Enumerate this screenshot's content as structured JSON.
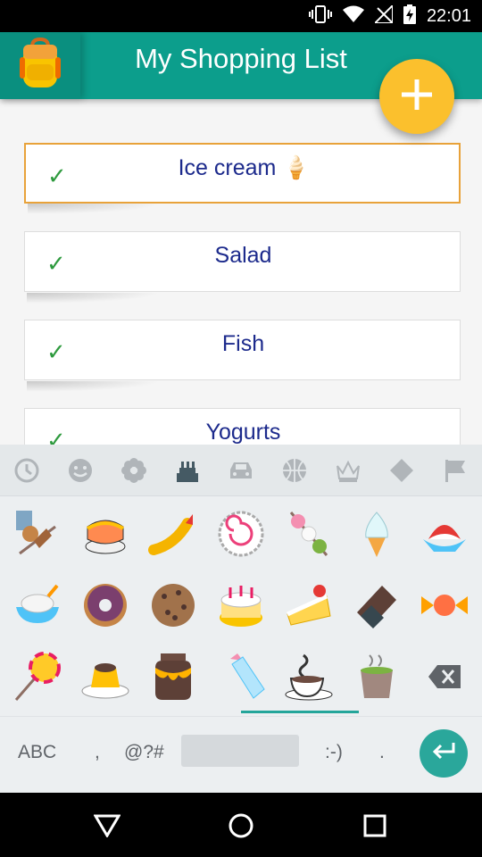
{
  "status_bar": {
    "time": "22:01",
    "icons": [
      "vibrate-icon",
      "wifi-icon",
      "no-signal-icon",
      "battery-charging-icon"
    ]
  },
  "app": {
    "title": "My Shopping List",
    "logo_icon": "backpack-icon",
    "accent": "#0c9e8c",
    "fab_color": "#fbc02d"
  },
  "list": {
    "items": [
      {
        "label": "Ice cream 🍦",
        "checked": true,
        "selected": true
      },
      {
        "label": "Salad",
        "checked": true,
        "selected": false
      },
      {
        "label": "Fish",
        "checked": true,
        "selected": false
      },
      {
        "label": "Yogurts",
        "checked": true,
        "selected": false
      }
    ],
    "check_mark": "✓"
  },
  "keyboard": {
    "categories": [
      "recent-clock-icon",
      "smiley-icon",
      "flower-icon",
      "food-cake-icon",
      "car-icon",
      "ball-icon",
      "crown-icon",
      "diamond-icon",
      "flag-icon"
    ],
    "active_category": "food-cake-icon",
    "emoji_rows": [
      [
        "oden-icon",
        "sushi-icon",
        "fried-shrimp-icon",
        "fish-cake-icon",
        "dango-icon",
        "soft-ice-cream-icon",
        "shaved-ice-icon"
      ],
      [
        "ice-cream-bowl-icon",
        "doughnut-icon",
        "cookie-icon",
        "birthday-cake-icon",
        "shortcake-icon",
        "chocolate-bar-icon",
        "candy-icon"
      ],
      [
        "lollipop-icon",
        "custard-icon",
        "honey-pot-icon",
        "baby-bottle-icon",
        "hot-beverage-icon",
        "tea-cup-icon",
        "backspace-icon"
      ]
    ],
    "bottom": {
      "abc": "ABC",
      "comma": ",",
      "symbols": "@?#",
      "emoticon": ":-)",
      "period": "."
    }
  },
  "nav_bar": {
    "back": "back-icon",
    "home": "home-icon",
    "recents": "recents-icon"
  }
}
